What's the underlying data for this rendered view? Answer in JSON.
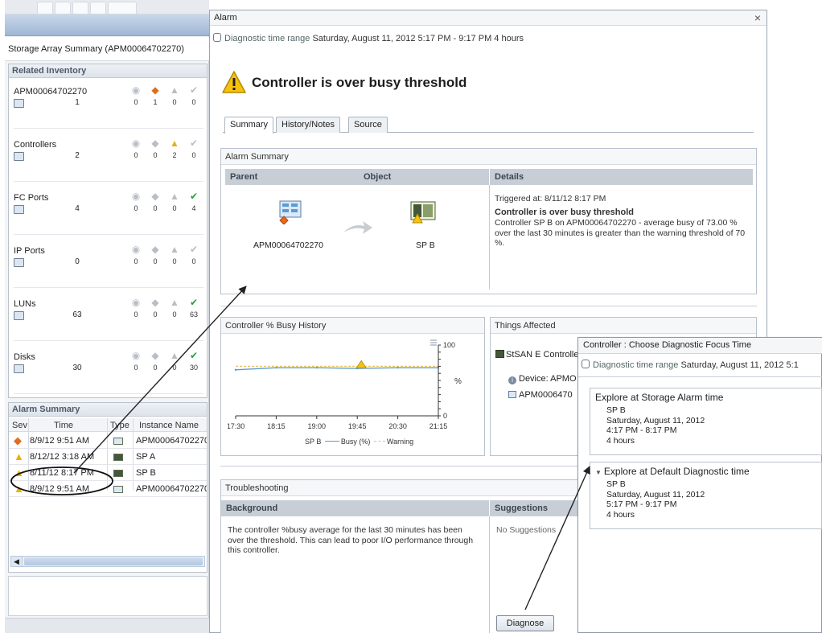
{
  "left": {
    "storage_title": "Storage Array Summary (APM00064702270)",
    "related_title": "Related Inventory",
    "inventory": [
      {
        "name": "APM00064702270",
        "count": "1",
        "sev": [
          "0",
          "1",
          "0",
          "0"
        ]
      },
      {
        "name": "Controllers",
        "count": "2",
        "sev": [
          "0",
          "0",
          "2",
          "0"
        ]
      },
      {
        "name": "FC Ports",
        "count": "4",
        "sev": [
          "0",
          "0",
          "0",
          "4"
        ]
      },
      {
        "name": "IP Ports",
        "count": "0",
        "sev": [
          "0",
          "0",
          "0",
          "0"
        ]
      },
      {
        "name": "LUNs",
        "count": "63",
        "sev": [
          "0",
          "0",
          "0",
          "63"
        ]
      },
      {
        "name": "Disks",
        "count": "30",
        "sev": [
          "0",
          "0",
          "0",
          "30"
        ]
      }
    ],
    "alarm_summary_title": "Alarm Summary",
    "columns": [
      "Sev",
      "Time",
      "Type",
      "Instance Name"
    ],
    "alarms": [
      {
        "time": "8/9/12 9:51 AM",
        "instance": "APM00064702270"
      },
      {
        "time": "8/12/12 3:18 AM",
        "instance": "SP A"
      },
      {
        "time": "8/11/12 8:17 PM",
        "instance": "SP B"
      },
      {
        "time": "8/9/12 9:51 AM",
        "instance": "APM00064702270"
      }
    ]
  },
  "alarm": {
    "window_title": "Alarm",
    "close": "×",
    "range_label": "Diagnostic time range",
    "range_value": "Saturday, August 11, 2012  5:17 PM - 9:17 PM  4 hours",
    "heading": "Controller is over busy threshold",
    "tabs": [
      "Summary",
      "History/Notes",
      "Source"
    ],
    "summary": {
      "title": "Alarm Summary",
      "parent_label": "Parent",
      "object_label": "Object",
      "details_label": "Details",
      "parent_name": "APM00064702270",
      "object_name": "SP B",
      "triggered": "Triggered at: 8/11/12 8:17 PM",
      "details_heading": "Controller is over busy threshold",
      "details_text": "Controller SP B on APM00064702270 - average busy of 73.00 % over the last 30 minutes is greater than the warning threshold of 70 %."
    },
    "busy": {
      "title": "Controller % Busy History",
      "legend_series": "SP B",
      "legend_busy": "Busy (%)",
      "legend_warning": "Warning"
    },
    "things": {
      "title": "Things Affected",
      "item": "StSAN E Controlle",
      "device": "Device: APMO",
      "array": "APM0006470"
    },
    "trouble": {
      "title": "Troubleshooting",
      "background_label": "Background",
      "suggestions_label": "Suggestions",
      "background_text": "The controller %busy average for the last 30 minutes has been over the threshold. This can lead to poor I/O performance through this controller.",
      "suggestions_text": "No Suggestions",
      "diagnose": "Diagnose"
    }
  },
  "popup": {
    "title": "Controller : Choose Diagnostic Focus Time",
    "range_label": "Diagnostic time range",
    "range_value": "Saturday, August 11, 2012  5:1",
    "storage": {
      "title": "Explore at Storage Alarm time",
      "lines": [
        "SP B",
        "Saturday, August 11, 2012",
        "4:17 PM - 8:17 PM",
        "4 hours"
      ]
    },
    "default": {
      "title": "Explore at Default Diagnostic time",
      "lines": [
        "SP B",
        "Saturday, August 11, 2012",
        "5:17 PM - 9:17 PM",
        "4 hours"
      ]
    }
  },
  "chart_data": {
    "type": "line",
    "x": [
      "17:30",
      "18:15",
      "19:00",
      "19:45",
      "20:30",
      "21:15"
    ],
    "series": [
      {
        "name": "Busy (%)",
        "values": [
          65,
          68,
          68,
          67,
          68,
          68
        ]
      },
      {
        "name": "Warning",
        "values": [
          70,
          70,
          70,
          70,
          70,
          70
        ]
      }
    ],
    "ylabel": "%",
    "ylim": [
      0,
      100
    ],
    "yticks": [
      "100",
      "0"
    ],
    "legend": "bottom"
  },
  "colors": {
    "busy_line": "#5b9bd5",
    "warning_line": "#e8c55a",
    "accent_blue": "#7f9cc4"
  }
}
